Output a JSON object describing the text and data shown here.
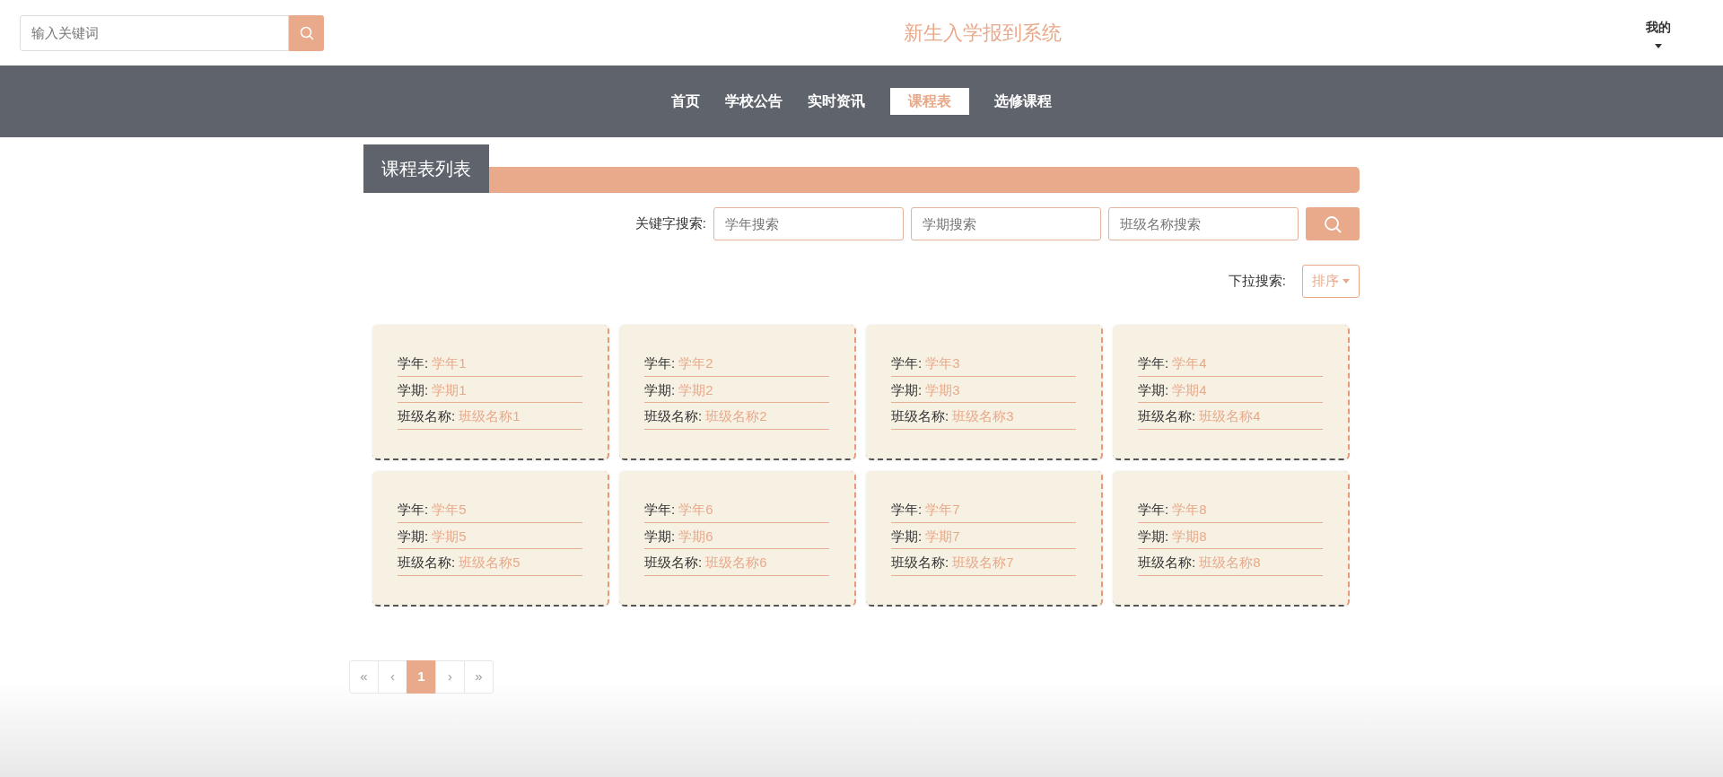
{
  "header": {
    "search": {
      "placeholder": "输入关键词"
    },
    "title": "新生入学报到系统",
    "user_menu": "我的"
  },
  "nav": [
    {
      "label": "首页",
      "selected": false
    },
    {
      "label": "学校公告",
      "selected": false
    },
    {
      "label": "实时资讯",
      "selected": false
    },
    {
      "label": "课程表",
      "selected": true
    },
    {
      "label": "选修课程",
      "selected": false
    }
  ],
  "section_title": "课程表列表",
  "filters": {
    "label": "关键字搜索:",
    "fields": [
      {
        "placeholder": "学年搜索"
      },
      {
        "placeholder": "学期搜索"
      },
      {
        "placeholder": "班级名称搜索"
      }
    ]
  },
  "sort": {
    "label": "下拉搜索:",
    "button": "排序"
  },
  "cards": [
    {
      "fields": [
        {
          "label": "学年:",
          "value": "学年1"
        },
        {
          "label": "学期:",
          "value": "学期1"
        },
        {
          "label": "班级名称:",
          "value": "班级名称1"
        }
      ]
    },
    {
      "fields": [
        {
          "label": "学年:",
          "value": "学年2"
        },
        {
          "label": "学期:",
          "value": "学期2"
        },
        {
          "label": "班级名称:",
          "value": "班级名称2"
        }
      ]
    },
    {
      "fields": [
        {
          "label": "学年:",
          "value": "学年3"
        },
        {
          "label": "学期:",
          "value": "学期3"
        },
        {
          "label": "班级名称:",
          "value": "班级名称3"
        }
      ]
    },
    {
      "fields": [
        {
          "label": "学年:",
          "value": "学年4"
        },
        {
          "label": "学期:",
          "value": "学期4"
        },
        {
          "label": "班级名称:",
          "value": "班级名称4"
        }
      ]
    },
    {
      "fields": [
        {
          "label": "学年:",
          "value": "学年5"
        },
        {
          "label": "学期:",
          "value": "学期5"
        },
        {
          "label": "班级名称:",
          "value": "班级名称5"
        }
      ]
    },
    {
      "fields": [
        {
          "label": "学年:",
          "value": "学年6"
        },
        {
          "label": "学期:",
          "value": "学期6"
        },
        {
          "label": "班级名称:",
          "value": "班级名称6"
        }
      ]
    },
    {
      "fields": [
        {
          "label": "学年:",
          "value": "学年7"
        },
        {
          "label": "学期:",
          "value": "学期7"
        },
        {
          "label": "班级名称:",
          "value": "班级名称7"
        }
      ]
    },
    {
      "fields": [
        {
          "label": "学年:",
          "value": "学年8"
        },
        {
          "label": "学期:",
          "value": "学期8"
        },
        {
          "label": "班级名称:",
          "value": "班级名称8"
        }
      ]
    }
  ],
  "pagination": [
    {
      "label": "«",
      "selected": false
    },
    {
      "label": "‹",
      "selected": false
    },
    {
      "label": "1",
      "selected": true
    },
    {
      "label": "›",
      "selected": false
    },
    {
      "label": "»",
      "selected": false
    }
  ]
}
